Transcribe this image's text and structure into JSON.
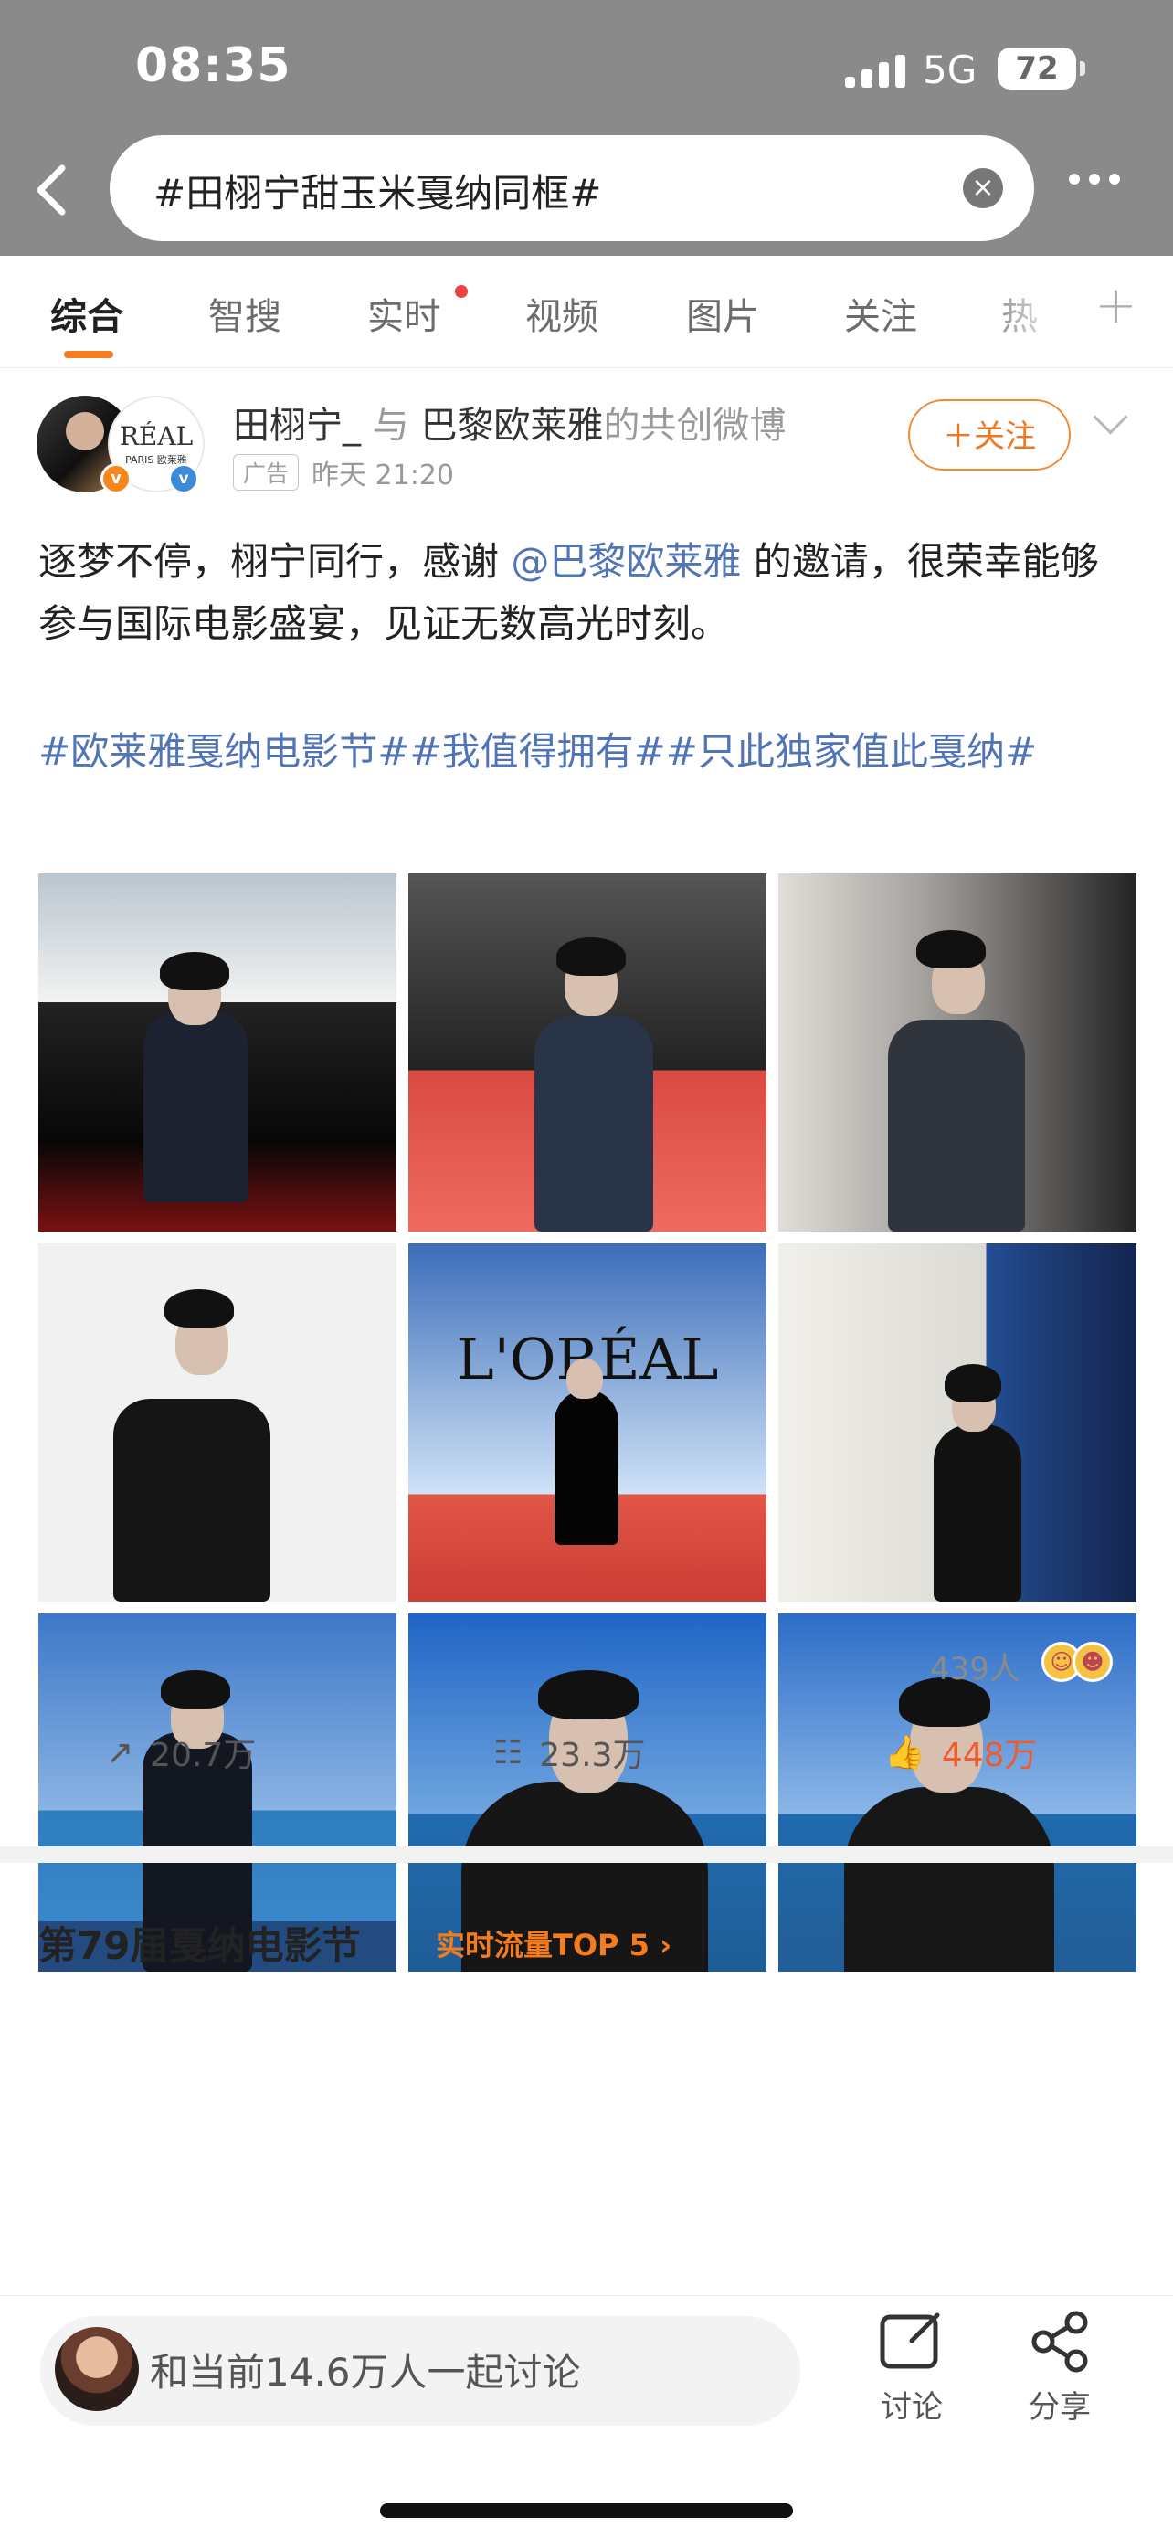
{
  "status": {
    "time": "08:35",
    "network": "5G",
    "battery": "72"
  },
  "search": {
    "query": "#田栩宁甜玉米戛纳同框#"
  },
  "tabs": [
    "综合",
    "智搜",
    "实时",
    "视频",
    "图片",
    "关注",
    "热"
  ],
  "post": {
    "author": "田栩宁_",
    "connector": "与",
    "brand": "巴黎欧莱雅",
    "suffix": "的共创微博",
    "ad_label": "广告",
    "time": "昨天 21:20",
    "follow": "＋关注",
    "text1": "逐梦不停，栩宁同行，感谢",
    "mention": "@巴黎欧莱雅",
    "text2": "的邀请，很荣幸能够参与国际电影盛宴，见证无数高光时刻。",
    "topics": "#欧莱雅戛纳电影节##我值得拥有##只此独家值此戛纳#"
  },
  "reactions": {
    "count_label": "439人"
  },
  "actions": {
    "forward": "20.7万",
    "comment": "23.3万",
    "like": "448万"
  },
  "section": {
    "title": "第79届戛纳电影节",
    "hot": "实时流量TOP 5 ›"
  },
  "bottom": {
    "comment_placeholder": "和当前14.6万人一起讨论",
    "discuss": "讨论",
    "share": "分享"
  },
  "colors": {
    "accent": "#f77c21",
    "link": "#5074b6",
    "like": "#ef5b2b"
  }
}
